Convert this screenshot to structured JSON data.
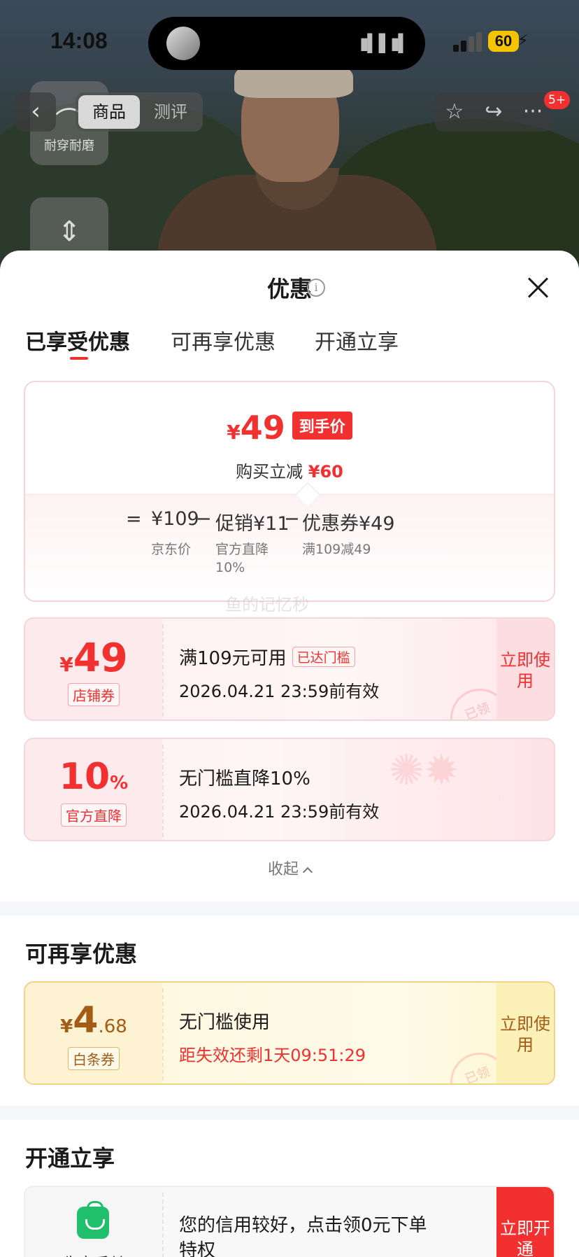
{
  "status_bar": {
    "time": "14:08",
    "battery": "60"
  },
  "nav": {
    "tabs": [
      "商品",
      "测评"
    ],
    "message_badge": "5+",
    "back_icon": "chevron-left-icon",
    "actions": [
      "star-icon",
      "share-icon",
      "more-icon"
    ]
  },
  "background": {
    "feature_label": "耐穿耐磨"
  },
  "sheet": {
    "title": "优惠",
    "tabs": [
      "已享受优惠",
      "可再享优惠",
      "开通立享"
    ],
    "summary": {
      "yen": "¥",
      "price": "49",
      "price_tag": "到手价",
      "reduce_label": "购买立减",
      "reduce_value": "¥60",
      "equals": "=",
      "minus": "−",
      "items": [
        {
          "value": "¥109",
          "label": "京东价"
        },
        {
          "value": "促销¥11",
          "label": "官方直降10%"
        },
        {
          "value": "优惠券¥49",
          "label": "满109减49"
        }
      ]
    },
    "watermark": "鱼的记忆秒",
    "applied_coupons": [
      {
        "yen": "¥",
        "value": "49",
        "unit": "",
        "chip": "店铺券",
        "line1": "满109元可用",
        "tag": "已达门槛",
        "line2": "2026.04.21 23:59前有效",
        "cta": "立即使用",
        "stamp": "已领"
      },
      {
        "yen": "",
        "value": "10",
        "unit": "%",
        "chip": "官方直降",
        "line1": "无门槛直降10%",
        "tag": "",
        "line2": "2026.04.21 23:59前有效",
        "cta": "",
        "stamp": ""
      }
    ],
    "collapse_label": "收起",
    "more_section": {
      "title": "可再享优惠",
      "coupon": {
        "yen": "¥",
        "value": "4",
        "decimal": ".68",
        "chip": "白条券",
        "line1": "无门槛使用",
        "line2": "距失效还剩1天09:51:29",
        "cta": "立即使用",
        "stamp": "已领"
      }
    },
    "open_section": {
      "title": "开通立享",
      "card": {
        "icon": "shopping-bag-icon",
        "label": "先享后付",
        "line1": "您的信用较好，点击领0元下单",
        "line2": "特权",
        "cta": "立即开通"
      }
    }
  },
  "colors": {
    "accent_red": "#f23030",
    "gold": "#a25c16",
    "green": "#1fbf6b"
  }
}
